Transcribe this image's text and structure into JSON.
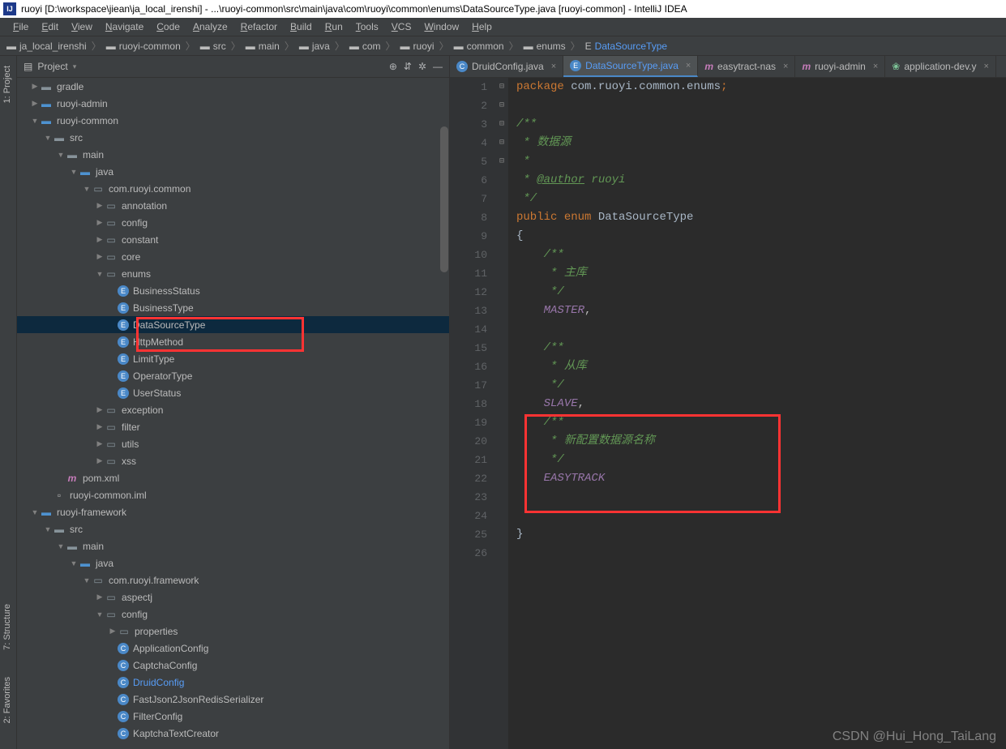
{
  "window": {
    "title": "ruoyi [D:\\workspace\\jiean\\ja_local_irenshi] - ...\\ruoyi-common\\src\\main\\java\\com\\ruoyi\\common\\enums\\DataSourceType.java [ruoyi-common] - IntelliJ IDEA"
  },
  "menu": [
    "File",
    "Edit",
    "View",
    "Navigate",
    "Code",
    "Analyze",
    "Refactor",
    "Build",
    "Run",
    "Tools",
    "VCS",
    "Window",
    "Help"
  ],
  "breadcrumb": [
    "ja_local_irenshi",
    "ruoyi-common",
    "src",
    "main",
    "java",
    "com",
    "ruoyi",
    "common",
    "enums",
    "DataSourceType"
  ],
  "project_panel": {
    "title": "Project"
  },
  "side_labels": {
    "project": "1: Project",
    "structure": "7: Structure",
    "favorites": "2: Favorites"
  },
  "tree": [
    {
      "d": 1,
      "t": "gradle",
      "i": "dir",
      "a": "r"
    },
    {
      "d": 1,
      "t": "ruoyi-admin",
      "i": "mdir",
      "a": "r"
    },
    {
      "d": 1,
      "t": "ruoyi-common",
      "i": "mdir",
      "a": "d"
    },
    {
      "d": 2,
      "t": "src",
      "i": "dir",
      "a": "d"
    },
    {
      "d": 3,
      "t": "main",
      "i": "dir",
      "a": "d"
    },
    {
      "d": 4,
      "t": "java",
      "i": "mdir",
      "a": "d"
    },
    {
      "d": 5,
      "t": "com.ruoyi.common",
      "i": "pkg",
      "a": "d"
    },
    {
      "d": 6,
      "t": "annotation",
      "i": "pkg",
      "a": "r"
    },
    {
      "d": 6,
      "t": "config",
      "i": "pkg",
      "a": "r"
    },
    {
      "d": 6,
      "t": "constant",
      "i": "pkg",
      "a": "r"
    },
    {
      "d": 6,
      "t": "core",
      "i": "pkg",
      "a": "r"
    },
    {
      "d": 6,
      "t": "enums",
      "i": "pkg",
      "a": "d"
    },
    {
      "d": 7,
      "t": "BusinessStatus",
      "i": "e",
      "a": ""
    },
    {
      "d": 7,
      "t": "BusinessType",
      "i": "e",
      "a": ""
    },
    {
      "d": 7,
      "t": "DataSourceType",
      "i": "e",
      "a": "",
      "sel": true
    },
    {
      "d": 7,
      "t": "HttpMethod",
      "i": "e",
      "a": ""
    },
    {
      "d": 7,
      "t": "LimitType",
      "i": "e",
      "a": ""
    },
    {
      "d": 7,
      "t": "OperatorType",
      "i": "e",
      "a": ""
    },
    {
      "d": 7,
      "t": "UserStatus",
      "i": "e",
      "a": ""
    },
    {
      "d": 6,
      "t": "exception",
      "i": "pkg",
      "a": "r"
    },
    {
      "d": 6,
      "t": "filter",
      "i": "pkg",
      "a": "r"
    },
    {
      "d": 6,
      "t": "utils",
      "i": "pkg",
      "a": "r"
    },
    {
      "d": 6,
      "t": "xss",
      "i": "pkg",
      "a": "r"
    },
    {
      "d": 3,
      "t": "pom.xml",
      "i": "m",
      "a": ""
    },
    {
      "d": 2,
      "t": "ruoyi-common.iml",
      "i": "file",
      "a": ""
    },
    {
      "d": 1,
      "t": "ruoyi-framework",
      "i": "mdir",
      "a": "d"
    },
    {
      "d": 2,
      "t": "src",
      "i": "dir",
      "a": "d"
    },
    {
      "d": 3,
      "t": "main",
      "i": "dir",
      "a": "d"
    },
    {
      "d": 4,
      "t": "java",
      "i": "mdir",
      "a": "d"
    },
    {
      "d": 5,
      "t": "com.ruoyi.framework",
      "i": "pkg",
      "a": "d"
    },
    {
      "d": 6,
      "t": "aspectj",
      "i": "pkg",
      "a": "r"
    },
    {
      "d": 6,
      "t": "config",
      "i": "pkg",
      "a": "d"
    },
    {
      "d": 7,
      "t": "properties",
      "i": "pkg",
      "a": "r"
    },
    {
      "d": 7,
      "t": "ApplicationConfig",
      "i": "c",
      "a": ""
    },
    {
      "d": 7,
      "t": "CaptchaConfig",
      "i": "c",
      "a": ""
    },
    {
      "d": 7,
      "t": "DruidConfig",
      "i": "c",
      "a": "",
      "link": true
    },
    {
      "d": 7,
      "t": "FastJson2JsonRedisSerializer",
      "i": "c",
      "a": ""
    },
    {
      "d": 7,
      "t": "FilterConfig",
      "i": "c",
      "a": ""
    },
    {
      "d": 7,
      "t": "KaptchaTextCreator",
      "i": "c",
      "a": ""
    }
  ],
  "editor_tabs": [
    {
      "label": "DruidConfig.java",
      "icon": "c"
    },
    {
      "label": "DataSourceType.java",
      "icon": "e",
      "active": true
    },
    {
      "label": "easytract-nas",
      "icon": "m"
    },
    {
      "label": "ruoyi-admin",
      "icon": "m"
    },
    {
      "label": "application-dev.y",
      "icon": "leaf"
    }
  ],
  "code_lines": [
    {
      "n": 1,
      "html": "<span class='kw'>package</span> <span class='pkgpath'>com.ruoyi.common.enums</span><span class='semicolon'>;</span>"
    },
    {
      "n": 2,
      "html": ""
    },
    {
      "n": 3,
      "html": "<span class='comment'>/**</span>",
      "fold": "⊟"
    },
    {
      "n": 4,
      "html": "<span class='comment'> * 数据源</span>"
    },
    {
      "n": 5,
      "html": "<span class='comment'> *</span>"
    },
    {
      "n": 6,
      "html": "<span class='comment'> * <span class='doctag'>@author</span> ruoyi</span>"
    },
    {
      "n": 7,
      "html": "<span class='comment'> */</span>",
      "fold": "⊟"
    },
    {
      "n": 8,
      "html": "<span class='kw'>public</span> <span class='kw'>enum</span> <span class='enum-name'>DataSourceType</span>"
    },
    {
      "n": 9,
      "html": "<span class='enum-name'>{</span>"
    },
    {
      "n": 10,
      "html": "    <span class='comment'>/**</span>",
      "fold": "⊟"
    },
    {
      "n": 11,
      "html": "    <span class='comment'> * 主库</span>"
    },
    {
      "n": 12,
      "html": "    <span class='comment'> */</span>"
    },
    {
      "n": 13,
      "html": "    <span class='const'>MASTER</span>,"
    },
    {
      "n": 14,
      "html": ""
    },
    {
      "n": 15,
      "html": "    <span class='comment'>/**</span>",
      "fold": "⊟"
    },
    {
      "n": 16,
      "html": "    <span class='comment'> * 从库</span>"
    },
    {
      "n": 17,
      "html": "    <span class='comment'> */</span>"
    },
    {
      "n": 18,
      "html": "    <span class='const'>SLAVE</span>,"
    },
    {
      "n": 19,
      "html": "    <span class='comment'>/**</span>",
      "fold": "⊟"
    },
    {
      "n": 20,
      "html": "    <span class='comment'> * 新配置数据源名称</span>"
    },
    {
      "n": 21,
      "html": "    <span class='comment'> */</span>"
    },
    {
      "n": 22,
      "html": "    <span class='const'>EASYTRACK</span>"
    },
    {
      "n": 23,
      "html": ""
    },
    {
      "n": 24,
      "html": ""
    },
    {
      "n": 25,
      "html": "<span class='enum-name'>}</span>"
    },
    {
      "n": 26,
      "html": ""
    }
  ],
  "watermark": "CSDN @Hui_Hong_TaiLang"
}
